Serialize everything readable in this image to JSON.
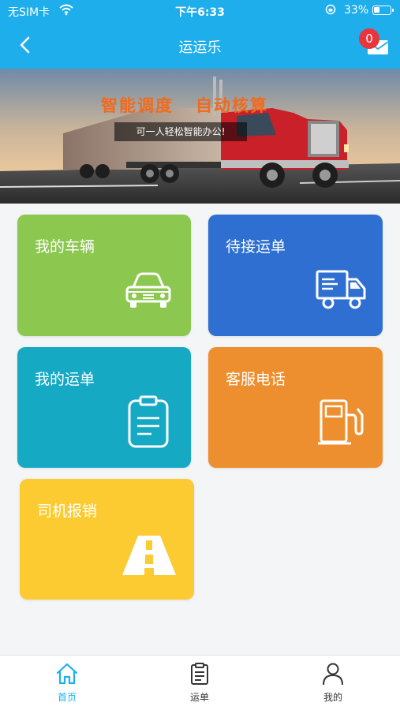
{
  "status_bar": {
    "carrier": "无SIM卡",
    "time": "下午6:33",
    "battery": "33%",
    "icons": [
      "wifi-icon",
      "orientation-lock-icon",
      "battery-icon"
    ]
  },
  "navbar": {
    "title": "运运乐",
    "badge_count": "0",
    "icons": [
      "back-icon",
      "mail-icon"
    ]
  },
  "banner": {
    "headline": "智能调度   自动核算",
    "subline": "可一人轻松智能办公!"
  },
  "grid": {
    "items": [
      {
        "label": "我的车辆",
        "icon": "car-icon",
        "color": "#8cc750"
      },
      {
        "label": "待接运单",
        "icon": "truck-icon",
        "color": "#2e6fd1"
      },
      {
        "label": "我的运单",
        "icon": "clipboard-icon",
        "color": "#16a9c4"
      },
      {
        "label": "客服电话",
        "icon": "fuel-pump-icon",
        "color": "#ed8f2f"
      },
      {
        "label": "司机报销",
        "icon": "road-icon",
        "color": "#fccb32"
      }
    ]
  },
  "tabbar": {
    "tabs": [
      {
        "label": "首页",
        "icon": "home-icon",
        "active": true
      },
      {
        "label": "运单",
        "icon": "list-icon",
        "active": false
      },
      {
        "label": "我的",
        "icon": "user-icon",
        "active": false
      }
    ]
  },
  "colors": {
    "primary": "#1eaeec",
    "badge": "#e8343c",
    "banner_headline": "#f16a1d"
  }
}
